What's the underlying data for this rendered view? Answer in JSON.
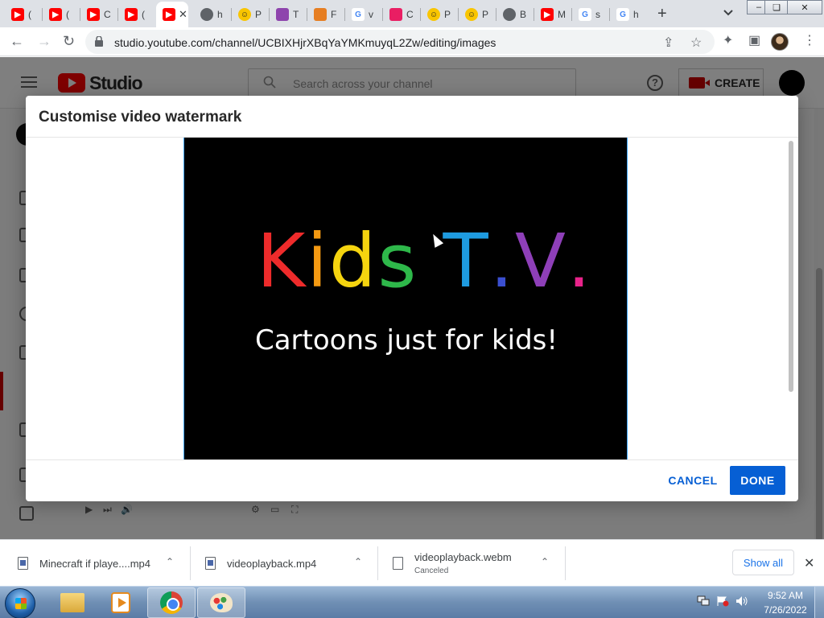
{
  "browser": {
    "tabs": [
      {
        "label": "(",
        "favicon": "youtube-icon",
        "color": "#ff0000"
      },
      {
        "label": "(",
        "favicon": "youtube-icon",
        "color": "#ff0000"
      },
      {
        "label": "C",
        "favicon": "youtube-icon",
        "color": "#ff0000"
      },
      {
        "label": "(",
        "favicon": "youtube-icon",
        "color": "#ff0000"
      },
      {
        "label": "",
        "favicon": "youtube-icon",
        "color": "#ff0000",
        "active": true
      },
      {
        "label": "h",
        "favicon": "globe-icon",
        "color": "#5f6368"
      },
      {
        "label": "P",
        "favicon": "smiley-icon",
        "color": "#f9c500"
      },
      {
        "label": "T",
        "favicon": "t-icon",
        "color": "#8e44ad"
      },
      {
        "label": "F",
        "favicon": "triangle-icon",
        "color": "#e67e22"
      },
      {
        "label": "v",
        "favicon": "google-icon",
        "color": "#4285f4"
      },
      {
        "label": "C",
        "favicon": "heart-icon",
        "color": "#e91e63"
      },
      {
        "label": "P",
        "favicon": "smiley-icon",
        "color": "#f9c500"
      },
      {
        "label": "P",
        "favicon": "smiley-icon",
        "color": "#f9c500"
      },
      {
        "label": "B",
        "favicon": "globe-icon",
        "color": "#5f6368"
      },
      {
        "label": "M",
        "favicon": "youtube-icon",
        "color": "#ff0000"
      },
      {
        "label": "s",
        "favicon": "google-icon",
        "color": "#4285f4"
      },
      {
        "label": "h",
        "favicon": "google-icon",
        "color": "#4285f4"
      }
    ],
    "new_tab": "+",
    "url": "studio.youtube.com/channel/UCBIXHjrXBqYaYMKmuyqL2Zw/editing/images"
  },
  "studio": {
    "logo_text": "Studio",
    "search_placeholder": "Search across your channel",
    "help": "?",
    "create_label": "CREATE"
  },
  "dialog": {
    "title": "Customise video watermark",
    "image": {
      "title_letters": [
        {
          "char": "K",
          "color": "#ee2b2b"
        },
        {
          "char": "i",
          "color": "#f59a12"
        },
        {
          "char": "d",
          "color": "#f5d40f"
        },
        {
          "char": "s",
          "color": "#2eb84a"
        },
        {
          "char": " ",
          "color": "#000000"
        },
        {
          "char": "T",
          "color": "#1e9be0"
        },
        {
          "char": ".",
          "color": "#3b4fd0"
        },
        {
          "char": "V",
          "color": "#8e3fb8"
        },
        {
          "char": ".",
          "color": "#e8238a"
        }
      ],
      "subtitle": "Cartoons just for kids!"
    },
    "cancel_label": "CANCEL",
    "done_label": "DONE"
  },
  "downloads": {
    "items": [
      {
        "name": "Minecraft if playe....mp4",
        "status": ""
      },
      {
        "name": "videoplayback.mp4",
        "status": ""
      },
      {
        "name": "videoplayback.webm",
        "status": "Canceled"
      }
    ],
    "show_all": "Show all",
    "close": "✕"
  },
  "taskbar": {
    "time": "9:52 AM",
    "date": "7/26/2022"
  },
  "colors": {
    "accent": "#065fd4",
    "youtube_red": "#ff0000"
  }
}
